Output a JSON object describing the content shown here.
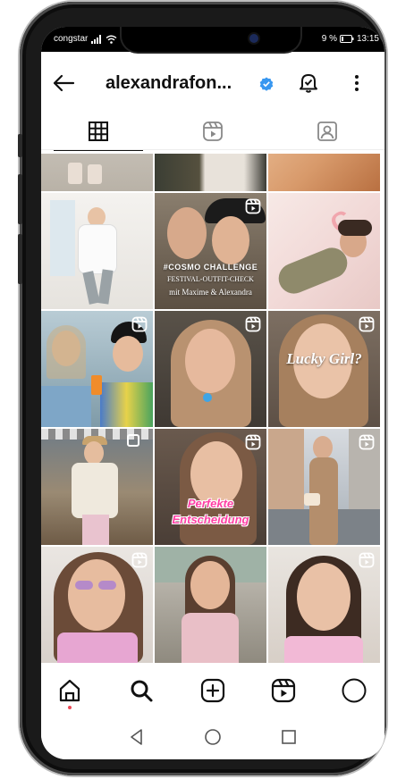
{
  "status": {
    "carrier": "congstar",
    "battery": "9 %",
    "time": "13:15"
  },
  "header": {
    "username": "alexandrafon...",
    "back_icon": "arrow-left-icon",
    "verified_icon": "verified-badge-icon",
    "bell_icon": "notification-bell-icon",
    "more_icon": "more-vertical-icon"
  },
  "tabs": [
    {
      "name": "posts",
      "icon": "grid-icon",
      "active": true
    },
    {
      "name": "reels",
      "icon": "reels-icon",
      "active": false
    },
    {
      "name": "tagged",
      "icon": "tagged-person-icon",
      "active": false
    }
  ],
  "grid": {
    "captions": {
      "cosmo": "#COSMO CHALLENGE",
      "festival": "FESTIVAL-OUTFIT-CHECK",
      "names": "mit Maxime & Alexandra",
      "lucky": "Lucky Girl?",
      "perfekte": "Perfekte",
      "entscheidung": "Entscheidung"
    }
  },
  "bottom_nav": [
    {
      "name": "home",
      "icon": "home-icon"
    },
    {
      "name": "search",
      "icon": "search-icon"
    },
    {
      "name": "create",
      "icon": "add-post-icon"
    },
    {
      "name": "reels",
      "icon": "reels-icon"
    },
    {
      "name": "profile",
      "icon": "profile-avatar-icon"
    }
  ],
  "colors": {
    "accent_verified": "#3897f0",
    "notification_dot": "#ed4956",
    "caption_pink": "#ff3fa4"
  }
}
